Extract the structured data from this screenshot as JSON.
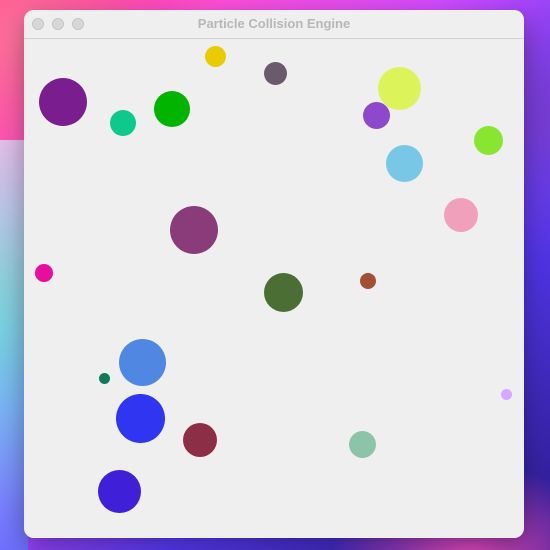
{
  "window": {
    "title": "Particle Collision Engine"
  },
  "particles": [
    {
      "id": "p1",
      "color": "#7a1d8f"
    },
    {
      "id": "p2",
      "color": "#0dc98c"
    },
    {
      "id": "p3",
      "color": "#00b400"
    },
    {
      "id": "p4",
      "color": "#e6cc00"
    },
    {
      "id": "p5",
      "color": "#6b5a6b"
    },
    {
      "id": "p6",
      "color": "#dcf35a"
    },
    {
      "id": "p7",
      "color": "#8e48cc"
    },
    {
      "id": "p8",
      "color": "#88e630"
    },
    {
      "id": "p9",
      "color": "#79c7e6"
    },
    {
      "id": "p10",
      "color": "#f0a0ba"
    },
    {
      "id": "p11",
      "color": "#8a3c7a"
    },
    {
      "id": "p12",
      "color": "#e80d9c"
    },
    {
      "id": "p13",
      "color": "#a25035"
    },
    {
      "id": "p14",
      "color": "#4a6e33"
    },
    {
      "id": "p15",
      "color": "#4f87e3"
    },
    {
      "id": "p16",
      "color": "#0e7a5a"
    },
    {
      "id": "p17",
      "color": "#d7a8ff"
    },
    {
      "id": "p18",
      "color": "#2f35f0"
    },
    {
      "id": "p19",
      "color": "#8c2e45"
    },
    {
      "id": "p20",
      "color": "#8cc4a8"
    },
    {
      "id": "p21",
      "color": "#3f1fd8"
    }
  ]
}
